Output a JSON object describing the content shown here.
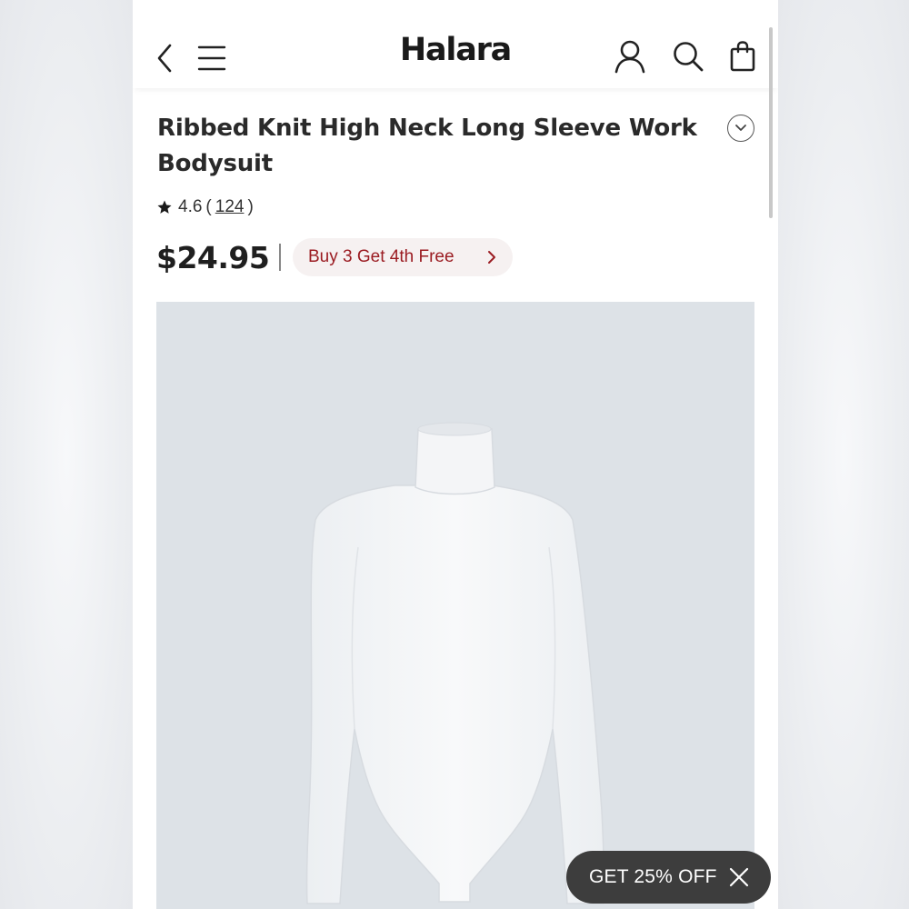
{
  "header": {
    "logo": "Halara",
    "icons": [
      "back-icon",
      "menu-icon",
      "account-icon",
      "search-icon",
      "bag-icon"
    ]
  },
  "product": {
    "title": "Ribbed Knit High Neck Long Sleeve Work Bodysuit",
    "rating": "4.6",
    "rating_open": "(",
    "review_count": "124",
    "rating_close": ")",
    "price": "$24.95",
    "promo_label": "Buy 3 Get 4th Free",
    "image_alt": "White ribbed knit high neck long sleeve bodysuit"
  },
  "popup": {
    "label": "GET 25% OFF"
  },
  "colors": {
    "promo_text": "#9b1c22",
    "promo_bg": "#f6f1f1",
    "image_bg": "#dde2e7",
    "popup_bg": "#3d3d3d"
  }
}
